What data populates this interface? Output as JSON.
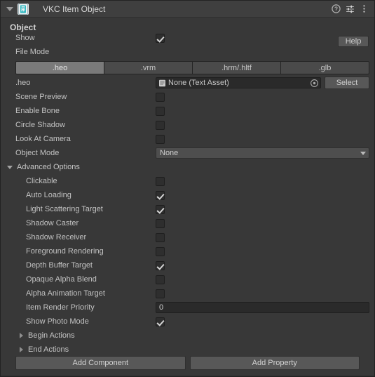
{
  "header": {
    "title": "VKC Item Object",
    "icon": "script-component-icon",
    "foldout_open": true,
    "buttons": [
      {
        "name": "help-icon",
        "label": "?"
      },
      {
        "name": "preset-icon",
        "label": "preset"
      },
      {
        "name": "more-menu-icon",
        "label": "⋮"
      }
    ]
  },
  "object_section": {
    "title": "Object",
    "help_label": "Help",
    "show": {
      "label": "Show",
      "checked": true
    },
    "file_mode": {
      "label": "File Mode",
      "tabs": [
        ".heo",
        ".vrm",
        ".hrm/.hltf",
        ".glb"
      ],
      "selected_index": 0
    },
    "asset_field": {
      "label": ".heo",
      "value": "None (Text Asset)",
      "select_label": "Select"
    },
    "toggles": [
      {
        "label": "Scene Preview",
        "checked": false
      },
      {
        "label": "Enable Bone",
        "checked": false
      },
      {
        "label": "Circle Shadow",
        "checked": false
      },
      {
        "label": "Look At Camera",
        "checked": false
      }
    ],
    "object_mode": {
      "label": "Object Mode",
      "value": "None"
    }
  },
  "advanced_options": {
    "label": "Advanced Options",
    "expanded": true,
    "toggles": [
      {
        "label": "Clickable",
        "checked": false
      },
      {
        "label": "Auto Loading",
        "checked": true
      },
      {
        "label": "Light Scattering Target",
        "checked": true
      },
      {
        "label": "Shadow Caster",
        "checked": false
      },
      {
        "label": "Shadow Receiver",
        "checked": false
      },
      {
        "label": "Foreground Rendering",
        "checked": false
      },
      {
        "label": "Depth Buffer Target",
        "checked": true
      },
      {
        "label": "Opaque Alpha Blend",
        "checked": false
      },
      {
        "label": "Alpha Animation Target",
        "checked": false
      }
    ],
    "item_render_priority": {
      "label": "Item Render Priority",
      "value": "0"
    },
    "show_photo_mode": {
      "label": "Show Photo Mode",
      "checked": true
    },
    "sub_foldouts": [
      {
        "label": "Begin Actions",
        "expanded": false
      },
      {
        "label": "End Actions",
        "expanded": false
      }
    ]
  },
  "footer": {
    "add_component_label": "Add Component",
    "add_property_label": "Add Property"
  },
  "colors": {
    "background": "#383838",
    "header_bar": "#3f3f3f",
    "accent_icon": "#2fb8c0",
    "button": "#585858",
    "field": "#2a2a2a",
    "tab_active": "#7a7a7a"
  }
}
